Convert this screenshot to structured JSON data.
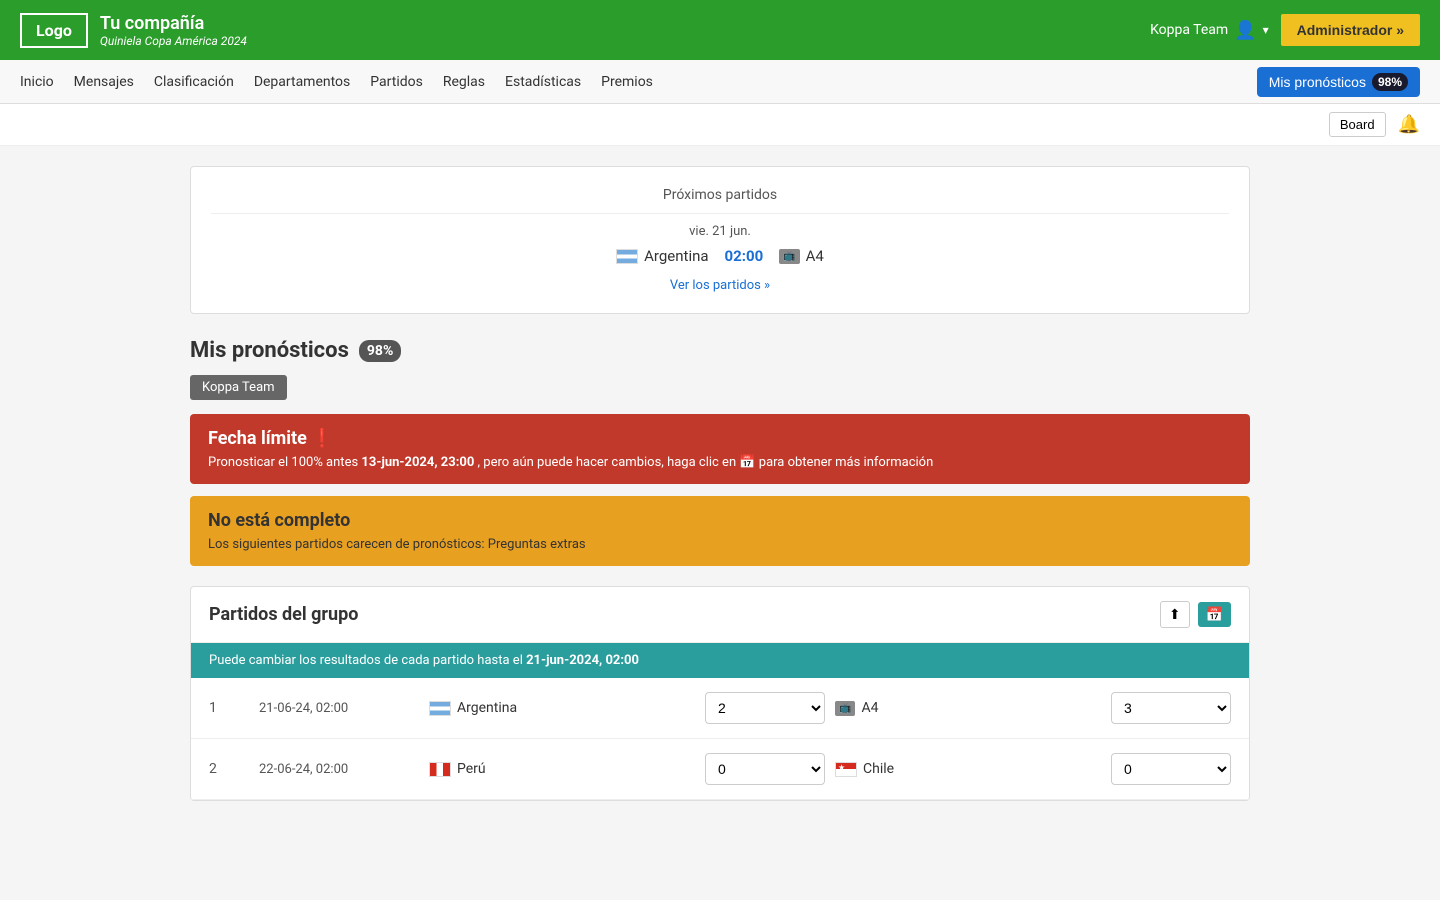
{
  "header": {
    "logo_label": "Logo",
    "company_name": "Tu compañía",
    "subtitle": "Quiniela Copa América 2024",
    "user_name": "Koppa Team",
    "admin_btn": "Administrador »"
  },
  "nav": {
    "links": [
      "Inicio",
      "Mensajes",
      "Clasificación",
      "Departamentos",
      "Partidos",
      "Reglas",
      "Estadísticas",
      "Premios"
    ],
    "mis_pronosticos_label": "Mis pronósticos",
    "badge": "98%"
  },
  "toolbar": {
    "board_label": "Board",
    "bell_aria": "Notificaciones"
  },
  "proximos": {
    "title": "Próximos partidos",
    "match_date": "vie. 21 jun.",
    "team_home": "Argentina",
    "match_time": "02:00",
    "team_away": "A4",
    "ver_partidos": "Ver los partidos »"
  },
  "mis_pronosticos": {
    "title": "Mis pronósticos",
    "badge": "98%",
    "team_tag": "Koppa Team"
  },
  "alert_fecha": {
    "title": "Fecha límite ❗",
    "body": "Pronosticar el 100% antes ",
    "date_bold": "13-jun-2024, 23:00",
    "body2": " , pero aún puede hacer cambios, haga clic en ",
    "cal_icon": "📅",
    "body3": " para obtener más información"
  },
  "alert_incompleto": {
    "title": "No está completo",
    "body": "Los siguientes partidos carecen de pronósticos: Preguntas extras"
  },
  "partidos_grupo": {
    "title": "Partidos del grupo",
    "info_bar": "Puede cambiar los resultados de cada partido hasta el ",
    "info_bar_date": "21-jun-2024, 02:00",
    "rows": [
      {
        "num": "1",
        "date": "21-06-24, 02:00",
        "team_home": "Argentina",
        "team_home_flag": "ar",
        "score_home": "2",
        "team_away": "A4",
        "team_away_flag": "a4",
        "score_away": "3"
      },
      {
        "num": "2",
        "date": "22-06-24, 02:00",
        "team_home": "Perú",
        "team_home_flag": "pe",
        "score_home": "0",
        "team_away": "Chile",
        "team_away_flag": "cl",
        "score_away": "0"
      }
    ]
  }
}
